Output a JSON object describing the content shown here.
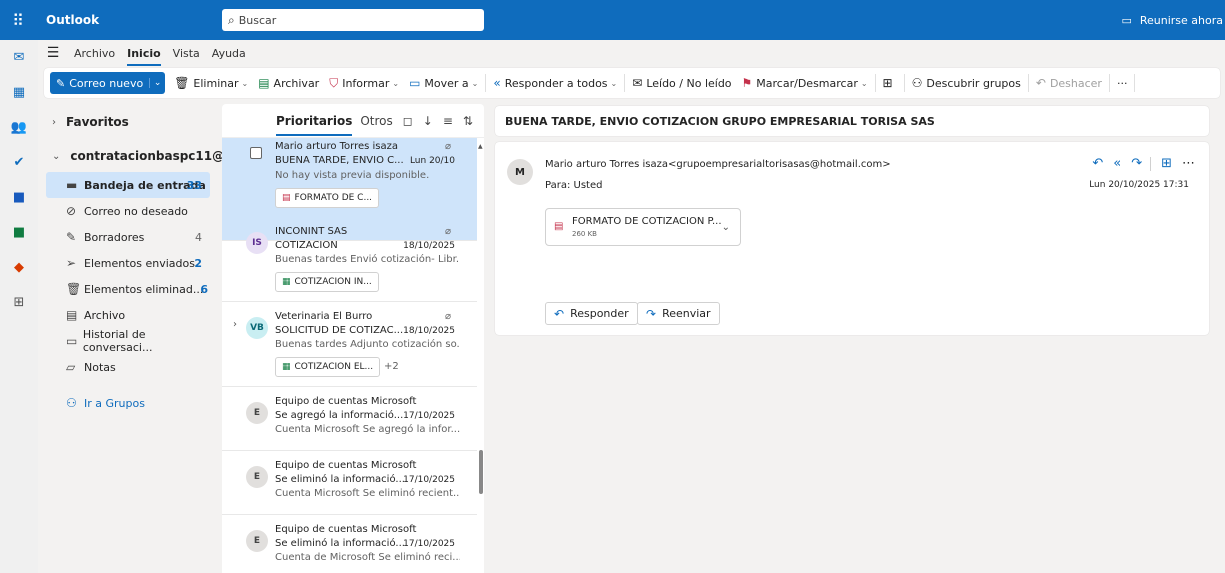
{
  "app": {
    "name": "Outlook",
    "waffle_icon": "waffle-icon"
  },
  "search": {
    "placeholder": "Buscar"
  },
  "meet_now": {
    "label": "Reunirse ahora"
  },
  "ribbon": {
    "tabs": [
      "Archivo",
      "Inicio",
      "Vista",
      "Ayuda"
    ],
    "active_tab": "Inicio"
  },
  "toolbar": {
    "new_mail": "Correo nuevo",
    "delete": "Eliminar",
    "archive": "Archivar",
    "report": "Informar",
    "move_to": "Mover a",
    "reply_all": "Responder a todos",
    "read_unread": "Leído / No leído",
    "flag": "Marcar/Desmarcar",
    "discover_groups": "Descubrir grupos",
    "undo": "Deshacer",
    "more": "···"
  },
  "folders": {
    "favorites": "Favoritos",
    "account": "contratacionbaspc11@...",
    "items": [
      {
        "label": "Bandeja de entrada",
        "count": "33"
      },
      {
        "label": "Correo no deseado",
        "count": ""
      },
      {
        "label": "Borradores",
        "count": "4"
      },
      {
        "label": "Elementos enviados",
        "count": "2"
      },
      {
        "label": "Elementos eliminad...",
        "count": "6"
      },
      {
        "label": "Archivo",
        "count": ""
      },
      {
        "label": "Historial de conversaci...",
        "count": ""
      },
      {
        "label": "Notas",
        "count": ""
      }
    ],
    "groups_link": "Ir a Grupos"
  },
  "list": {
    "focused_tab": "Prioritarios",
    "other_tab": "Otros",
    "messages": [
      {
        "sender": "Mario arturo Torres isaza",
        "subject": "BUENA TARDE, ENVIO C...",
        "date": "Lun 20/10",
        "preview": "No hay vista previa disponible.",
        "attachment": "FORMATO DE C...",
        "avatar": ""
      },
      {
        "sender": "INCONINT SAS",
        "subject": "COTIZACIÓN",
        "date": "18/10/2025",
        "preview": "Buenas tardes Envió cotización- Libr...",
        "attachment": "COTIZACION IN...",
        "avatar": "IS"
      },
      {
        "sender": "Veterinaria El Burro",
        "subject": "SOLICITUD DE COTIZAC...",
        "date": "18/10/2025",
        "preview": "Buenas tardes Adjunto cotización so...",
        "attachment": "COTIZACION EL...",
        "extra": "+2",
        "avatar": "VB"
      },
      {
        "sender": "Equipo de cuentas Microsoft",
        "subject": "Se agregó la informació...",
        "date": "17/10/2025",
        "preview": "Cuenta Microsoft Se agregó la infor...",
        "avatar": "E"
      },
      {
        "sender": "Equipo de cuentas Microsoft",
        "subject": "Se eliminó la informació...",
        "date": "17/10/2025",
        "preview": "Cuenta Microsoft Se eliminó recient...",
        "avatar": "E"
      },
      {
        "sender": "Equipo de cuentas Microsoft",
        "subject": "Se eliminó la informació...",
        "date": "17/10/2025",
        "preview": "Cuenta de Microsoft Se eliminó reci...",
        "avatar": "E"
      }
    ]
  },
  "reading": {
    "subject": "BUENA TARDE, ENVIO COTIZACION GRUPO EMPRESARIAL TORISA SAS",
    "avatar": "M",
    "from": "Mario arturo Torres isaza<grupoempresarialtorisasas@hotmail.com>",
    "to": "Para: Usted",
    "date": "Lun 20/10/2025 17:31",
    "attachment": {
      "name": "FORMATO DE COTIZACION P...",
      "size": "260 KB"
    },
    "reply": "Responder",
    "forward": "Reenviar"
  },
  "colors": {
    "accent": "#0f6cbd",
    "selected": "#cfe4fa",
    "avatar_is": "#e8e0f5",
    "avatar_vb": "#c9eef2",
    "avatar_e": "#e1dfdd"
  }
}
